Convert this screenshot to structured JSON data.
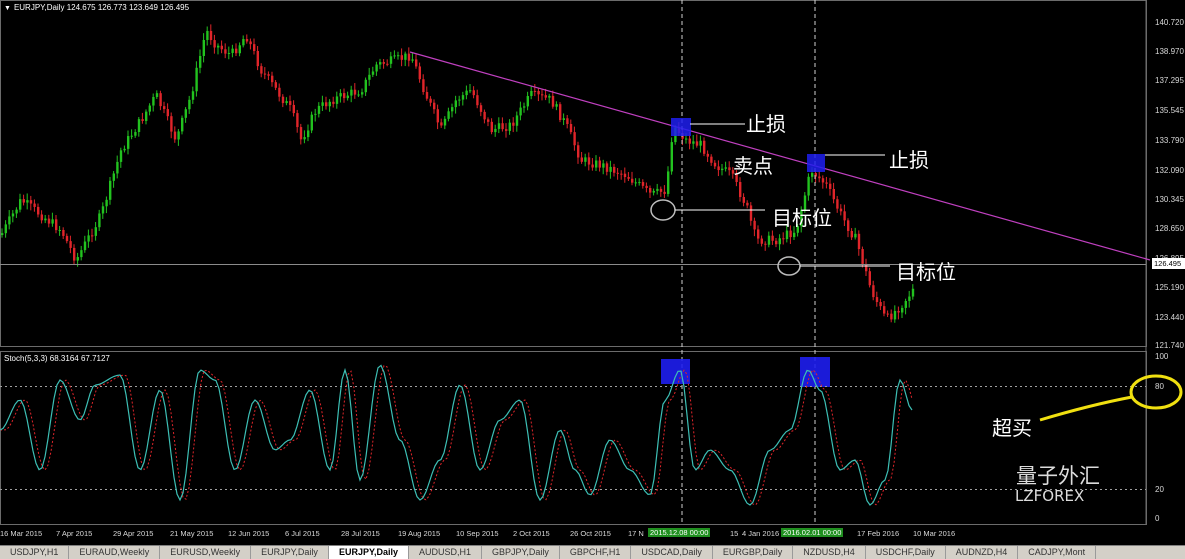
{
  "main_chart": {
    "header": "EURJPY,Daily  124.675 126.773 123.649 126.495",
    "price_ticks": [
      "140.720",
      "138.970",
      "137.295",
      "135.545",
      "133.790",
      "132.090",
      "130.345",
      "128.650",
      "126.895",
      "125.190",
      "123.440",
      "121.740"
    ],
    "current_price": "126.495",
    "colors": {
      "bull": "#22c21f",
      "bear": "#e0252a",
      "trendline": "#c040c0",
      "highlight": "#1e1ef0"
    }
  },
  "stoch": {
    "header": "Stoch(5,3,3) 68.3164 67.7127",
    "ticks": [
      "100",
      "80",
      "20",
      "0"
    ],
    "colors": {
      "main": "#3dbfb5",
      "signal": "#e0252a",
      "circle": "#f0e010"
    }
  },
  "annotations": {
    "stop_loss_1": "止损",
    "sell_point": "卖点",
    "stop_loss_2": "止损",
    "target_1": "目标位",
    "target_2": "目标位",
    "overbought": "超买",
    "brand_cn": "量子外汇",
    "brand_en": "LZFOREX"
  },
  "date_axis": {
    "labels": [
      "16 Mar 2015",
      "7 Apr 2015",
      "29 Apr 2015",
      "21 May 2015",
      "12 Jun 2015",
      "6 Jul 2015",
      "28 Jul 2015",
      "19 Aug 2015",
      "10 Sep 2015",
      "2 Oct 2015",
      "26 Oct 2015",
      "17 N",
      "15",
      "4 Jan 2016",
      "17 Feb 2016",
      "10 Mar 2016"
    ],
    "marker_1": "2015.12.08 00:00",
    "marker_2": "2016.02.01 00:00"
  },
  "tabs": [
    {
      "label": "USDJPY,H1"
    },
    {
      "label": "EURAUD,Weekly"
    },
    {
      "label": "EURUSD,Weekly"
    },
    {
      "label": "EURJPY,Daily"
    },
    {
      "label": "EURJPY,Daily",
      "active": true
    },
    {
      "label": "AUDUSD,H1"
    },
    {
      "label": "GBPJPY,Daily"
    },
    {
      "label": "GBPCHF,H1"
    },
    {
      "label": "USDCAD,Daily"
    },
    {
      "label": "EURGBP,Daily"
    },
    {
      "label": "NZDUSD,H4"
    },
    {
      "label": "USDCHF,Daily"
    },
    {
      "label": "AUDNZD,H4"
    },
    {
      "label": "CADJPY,Mont"
    }
  ]
}
